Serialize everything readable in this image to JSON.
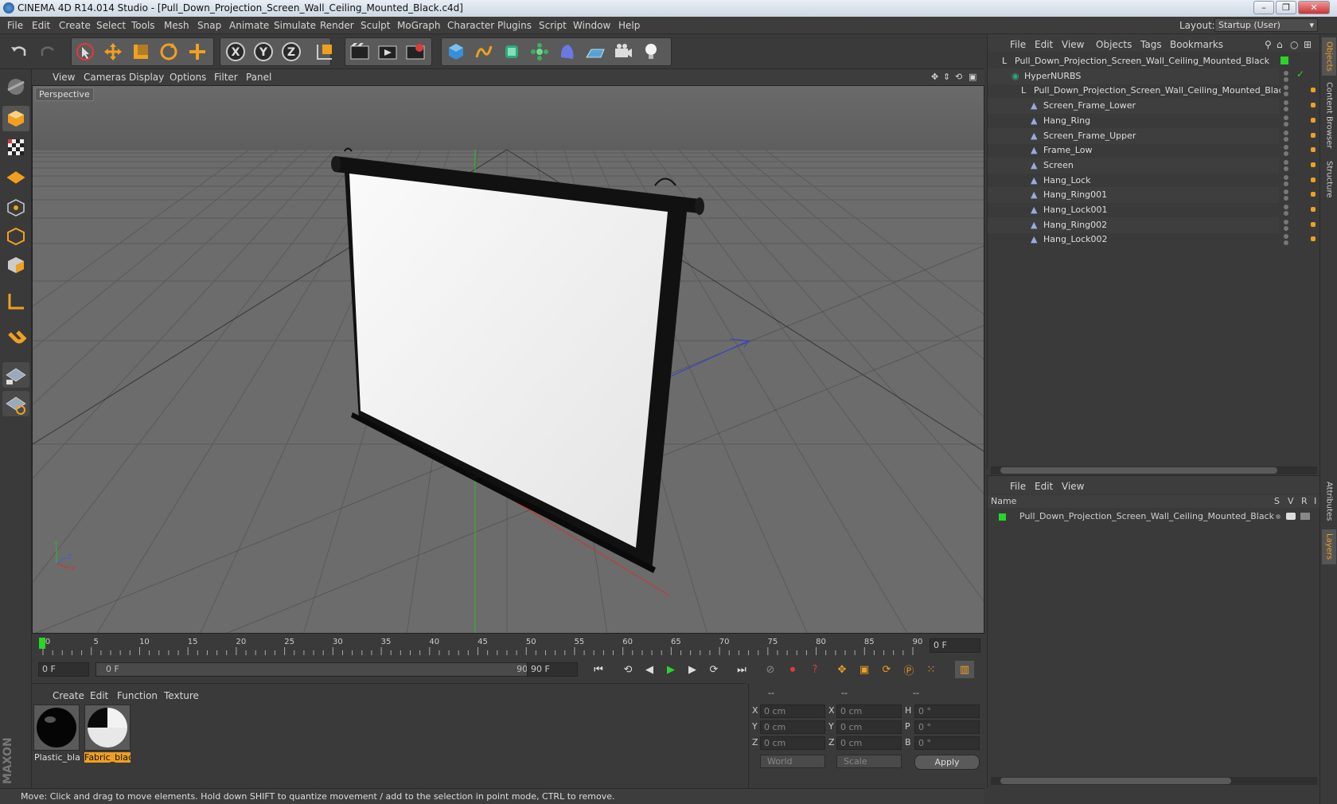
{
  "window": {
    "title": "CINEMA 4D R14.014 Studio - [Pull_Down_Projection_Screen_Wall_Ceiling_Mounted_Black.c4d]",
    "buttons": [
      "–",
      "❐",
      "✕"
    ]
  },
  "menubar": {
    "items": [
      "File",
      "Edit",
      "Create",
      "Select",
      "Tools",
      "Mesh",
      "Snap",
      "Animate",
      "Simulate",
      "Render",
      "Sculpt",
      "MoGraph",
      "Character",
      "Plugins",
      "Script",
      "Window",
      "Help"
    ],
    "layout_label": "Layout:",
    "layout_value": "Startup (User)"
  },
  "toolbar": {
    "icons": [
      "undo-icon",
      "redo-icon",
      "live-select-icon",
      "move-icon",
      "scale-icon",
      "rotate-icon",
      "add-icon",
      "x-axis-icon",
      "y-axis-icon",
      "z-axis-icon",
      "coord-system-icon",
      "render-view-icon",
      "render-picture-viewer-icon",
      "render-settings-icon",
      "cube-icon",
      "spline-icon",
      "nurbs-icon",
      "array-icon",
      "deformer-icon",
      "floor-icon",
      "camera-icon",
      "light-icon"
    ],
    "axis_labels": [
      "X",
      "Y",
      "Z"
    ]
  },
  "left_tools": [
    "make-editable-icon",
    "model-mode-icon",
    "texture-mode-icon",
    "workplane-icon",
    "points-mode-icon",
    "edges-mode-icon",
    "polygons-mode-icon",
    "axis-mode-icon",
    "snap-magnet-icon",
    "grid-lock-icon",
    "grid-snap-icon"
  ],
  "viewport": {
    "menu": [
      "View",
      "Cameras",
      "Display",
      "Options",
      "Filter",
      "Panel"
    ],
    "label": "Perspective"
  },
  "timeline": {
    "ticks": [
      "0",
      "5",
      "10",
      "15",
      "20",
      "25",
      "30",
      "35",
      "40",
      "45",
      "50",
      "55",
      "60",
      "65",
      "70",
      "75",
      "80",
      "85",
      "90"
    ],
    "current_frame": "0 F",
    "start_field": "0 F",
    "range_start": "0 F",
    "range_end": "90 F",
    "end_field": "90 F"
  },
  "materials": {
    "menu": [
      "Create",
      "Edit",
      "Function",
      "Texture"
    ],
    "items": [
      {
        "label": "Plastic_blac",
        "selected": false
      },
      {
        "label": "Fabric_blac",
        "selected": true
      }
    ]
  },
  "coords": {
    "headers": [
      "--",
      "--",
      "--"
    ],
    "rows": [
      {
        "a": "X",
        "av": "0 cm",
        "b": "X",
        "bv": "0 cm",
        "c": "H",
        "cv": "0 °"
      },
      {
        "a": "Y",
        "av": "0 cm",
        "b": "Y",
        "bv": "0 cm",
        "c": "P",
        "cv": "0 °"
      },
      {
        "a": "Z",
        "av": "0 cm",
        "b": "Z",
        "bv": "0 cm",
        "c": "B",
        "cv": "0 °"
      }
    ],
    "mode_world": "World",
    "mode_scale": "Scale",
    "apply": "Apply"
  },
  "status": "Move: Click and drag to move elements. Hold down SHIFT to quantize movement / add to the selection in point mode, CTRL to remove.",
  "objects": {
    "menu": [
      "File",
      "Edit",
      "View",
      "Objects",
      "Tags",
      "Bookmarks"
    ],
    "rows": [
      {
        "name": "Pull_Down_Projection_Screen_Wall_Ceiling_Mounted_Black",
        "type": "null"
      },
      {
        "name": "HyperNURBS",
        "type": "nurbs"
      },
      {
        "name": "Pull_Down_Projection_Screen_Wall_Ceiling_Mounted_Black",
        "type": "null"
      },
      {
        "name": "Screen_Frame_Lower",
        "type": "poly"
      },
      {
        "name": "Hang_Ring",
        "type": "poly"
      },
      {
        "name": "Screen_Frame_Upper",
        "type": "poly"
      },
      {
        "name": "Frame_Low",
        "type": "poly"
      },
      {
        "name": "Screen",
        "type": "poly"
      },
      {
        "name": "Hang_Lock",
        "type": "poly"
      },
      {
        "name": "Hang_Ring001",
        "type": "poly"
      },
      {
        "name": "Hang_Lock001",
        "type": "poly"
      },
      {
        "name": "Hang_Ring002",
        "type": "poly"
      },
      {
        "name": "Hang_Lock002",
        "type": "poly"
      }
    ]
  },
  "layers": {
    "menu": [
      "File",
      "Edit",
      "View"
    ],
    "columns": [
      "Name",
      "S",
      "V",
      "R",
      "I"
    ],
    "rows": [
      {
        "name": "Pull_Down_Projection_Screen_Wall_Ceiling_Mounted_Black"
      }
    ]
  },
  "side_tabs": [
    "Objects",
    "Content Browser",
    "Structure",
    "Attributes",
    "Layers"
  ],
  "colors": {
    "accent": "#f0a020",
    "green": "#27d627",
    "selected_bg": "#f0a020"
  }
}
